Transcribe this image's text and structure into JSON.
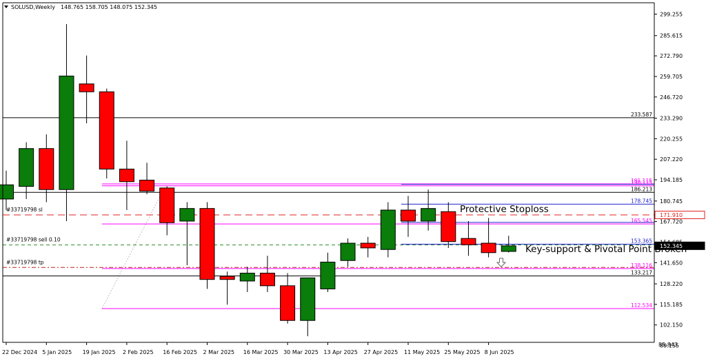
{
  "header": {
    "symbol": "SOLUSD,Weekly",
    "ohlc": "148.765 158.705 148.075 152.345"
  },
  "colors": {
    "bull": "#0a7d0a",
    "bear": "#ff0000",
    "axis": "#000000",
    "magenta": "#ff00ff",
    "blue": "#2222cc",
    "black": "#000000",
    "sl_red": "#e02020",
    "entry_green": "#2e8b2e",
    "tp_red": "#c02020",
    "fib_gray": "#c0c0c0"
  },
  "chart_data": {
    "type": "candlestick",
    "x_tick_labels": [
      "22 Dec 2024",
      "5 Jan 2025",
      "19 Jan 2025",
      "2 Feb 2025",
      "16 Feb 2025",
      "2 Mar 2025",
      "16 Mar 2025",
      "30 Mar 2025",
      "13 Apr 2025",
      "27 Apr 2025",
      "11 May 2025",
      "25 May 2025",
      "8 Jun 2025"
    ],
    "y_tick_labels": [
      "299.255",
      "285.615",
      "272.790",
      "259.705",
      "246.720",
      "233.290",
      "220.255",
      "207.220",
      "194.185",
      "180.745",
      "167.720",
      "154.685",
      "141.650",
      "128.220",
      "115.185",
      "102.150",
      "89.155"
    ],
    "y_range": [
      85.843,
      305
    ],
    "candles": [
      {
        "o": 182.0,
        "h": 200.0,
        "l": 175.0,
        "c": 191.0
      },
      {
        "o": 190.0,
        "h": 218.0,
        "l": 182.0,
        "c": 214.0
      },
      {
        "o": 214.0,
        "h": 223.0,
        "l": 180.0,
        "c": 188.0
      },
      {
        "o": 188.0,
        "h": 293.0,
        "l": 168.0,
        "c": 260.0
      },
      {
        "o": 255.0,
        "h": 273.0,
        "l": 230.0,
        "c": 250.0
      },
      {
        "o": 250.0,
        "h": 252.0,
        "l": 195.0,
        "c": 201.0
      },
      {
        "o": 201.0,
        "h": 219.0,
        "l": 175.0,
        "c": 193.0
      },
      {
        "o": 194.0,
        "h": 205.0,
        "l": 185.0,
        "c": 187.0
      },
      {
        "o": 189.0,
        "h": 190.0,
        "l": 159.0,
        "c": 167.0
      },
      {
        "o": 168.0,
        "h": 180.0,
        "l": 140.0,
        "c": 176.0
      },
      {
        "o": 176.0,
        "h": 180.0,
        "l": 125.0,
        "c": 131.0
      },
      {
        "o": 133.0,
        "h": 136.0,
        "l": 115.0,
        "c": 131.0
      },
      {
        "o": 130.0,
        "h": 139.0,
        "l": 123.0,
        "c": 135.0
      },
      {
        "o": 135.0,
        "h": 146.0,
        "l": 123.0,
        "c": 127.0
      },
      {
        "o": 127.0,
        "h": 135.0,
        "l": 103.0,
        "c": 105.0
      },
      {
        "o": 105.0,
        "h": 131.0,
        "l": 95.0,
        "c": 132.0
      },
      {
        "o": 125.0,
        "h": 148.0,
        "l": 123.0,
        "c": 142.0
      },
      {
        "o": 143.0,
        "h": 157.0,
        "l": 139.0,
        "c": 154.0
      },
      {
        "o": 154.0,
        "h": 158.0,
        "l": 145.0,
        "c": 151.0
      },
      {
        "o": 150.0,
        "h": 180.0,
        "l": 145.0,
        "c": 175.0
      },
      {
        "o": 175.0,
        "h": 184.0,
        "l": 158.0,
        "c": 168.0
      },
      {
        "o": 168.0,
        "h": 188.0,
        "l": 162.0,
        "c": 176.0
      },
      {
        "o": 174.0,
        "h": 180.0,
        "l": 151.0,
        "c": 155.0
      },
      {
        "o": 157.0,
        "h": 168.0,
        "l": 146.0,
        "c": 153.0
      },
      {
        "o": 154.0,
        "h": 170.0,
        "l": 145.0,
        "c": 148.0
      },
      {
        "o": 148.765,
        "h": 158.705,
        "l": 148.075,
        "c": 152.345
      }
    ],
    "hlines": [
      {
        "id": "level-233",
        "price": 233.587,
        "style": "black-solid",
        "span": "full",
        "label": "233.587",
        "label_color": "#000000"
      },
      {
        "id": "level-186",
        "price": 186.213,
        "style": "black-solid",
        "span": "full",
        "label": "186.213",
        "label_color": "#000000"
      },
      {
        "id": "level-133",
        "price": 133.217,
        "style": "black-solid",
        "span": "full",
        "label": "133.217",
        "label_color": "#000000"
      },
      {
        "id": "level-190-upper",
        "price": 191.6,
        "style": "magenta",
        "span": "fib",
        "label": "191.115",
        "label_color": "#ff00ff"
      },
      {
        "id": "level-190-lower",
        "price": 190.4,
        "style": "magenta",
        "span": "fib",
        "label": "190.115",
        "label_color": "#ff00ff"
      },
      {
        "id": "level-165",
        "price": 166.2,
        "style": "magenta",
        "span": "fib",
        "label": "165.545",
        "label_color": "#ff00ff"
      },
      {
        "id": "level-138",
        "price": 137.9,
        "style": "magenta",
        "span": "fib",
        "label": "138.116",
        "label_color": "#ff00ff"
      },
      {
        "id": "level-112",
        "price": 112.534,
        "style": "magenta",
        "span": "fib",
        "label": "112.534",
        "label_color": "#ff00ff"
      },
      {
        "id": "level-192",
        "price": 191.3,
        "style": "blue",
        "span": "blue",
        "label": "",
        "label_color": "#2222cc"
      },
      {
        "id": "level-178",
        "price": 178.745,
        "style": "blue",
        "span": "blue",
        "label": "178.745",
        "label_color": "#2222cc"
      },
      {
        "id": "level-166b",
        "price": 167.2,
        "style": "blue",
        "span": "blue",
        "label": "",
        "label_color": "#2222cc"
      },
      {
        "id": "level-153",
        "price": 153.365,
        "style": "blue",
        "span": "blue",
        "label": "153.365",
        "label_color": "#2222cc"
      }
    ],
    "price_tags": [
      {
        "id": "sl-tag",
        "price": 171.91,
        "label": "171.910",
        "fill": "#ffffff",
        "stroke": "#e02020",
        "text_color": "#e02020"
      },
      {
        "id": "current-tag",
        "price": 152.345,
        "label": "152.345",
        "fill": "#000000",
        "stroke": "#000000",
        "text_color": "#ffffff"
      }
    ],
    "trade_lines": [
      {
        "id": "sl-line",
        "price": 171.91,
        "label": "#33719798 sl",
        "style": "sl"
      },
      {
        "id": "entry-line",
        "price": 152.9,
        "label": "#33719798 sell 0.10",
        "style": "entry"
      },
      {
        "id": "tp-line",
        "price": 138.6,
        "label": "#33719798 tp",
        "style": "tp"
      }
    ],
    "annotations": {
      "stoploss_text": "Protective Stoploss",
      "support_text": "Key-support & Pivotal Point Broken",
      "bottom_label": "85.843"
    }
  }
}
